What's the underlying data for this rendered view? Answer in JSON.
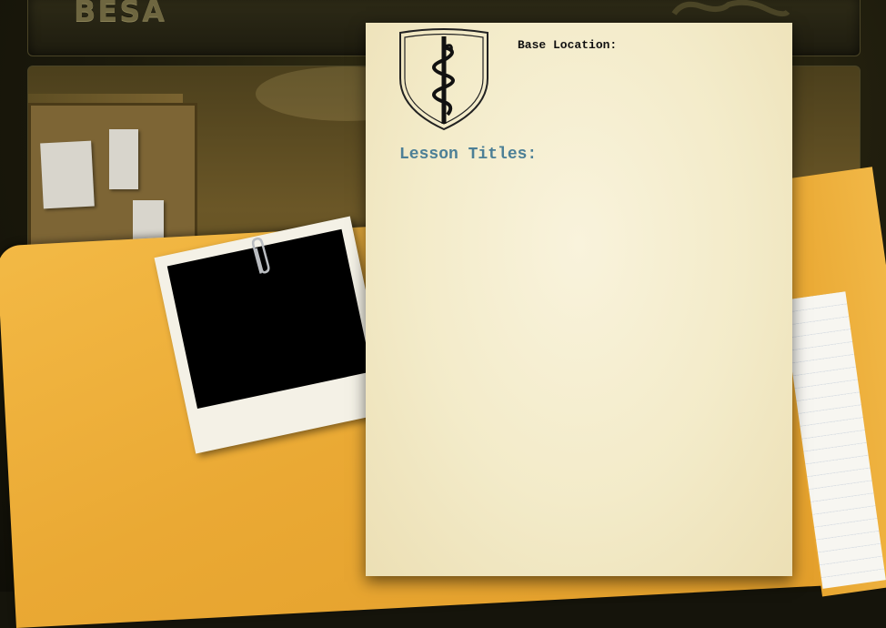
{
  "app": {
    "brand": "BESA"
  },
  "document": {
    "base_location_label": "Base Location:",
    "lesson_titles_label": "Lesson Titles:"
  },
  "icons": {
    "emblem": "staff-of-asclepius-shield-icon",
    "paperclip": "paperclip-icon"
  },
  "colors": {
    "folder": "#eaa934",
    "paper": "#f3ebc9",
    "lesson_heading": "#4c7f96",
    "photo_frame": "#f4f1e6"
  }
}
